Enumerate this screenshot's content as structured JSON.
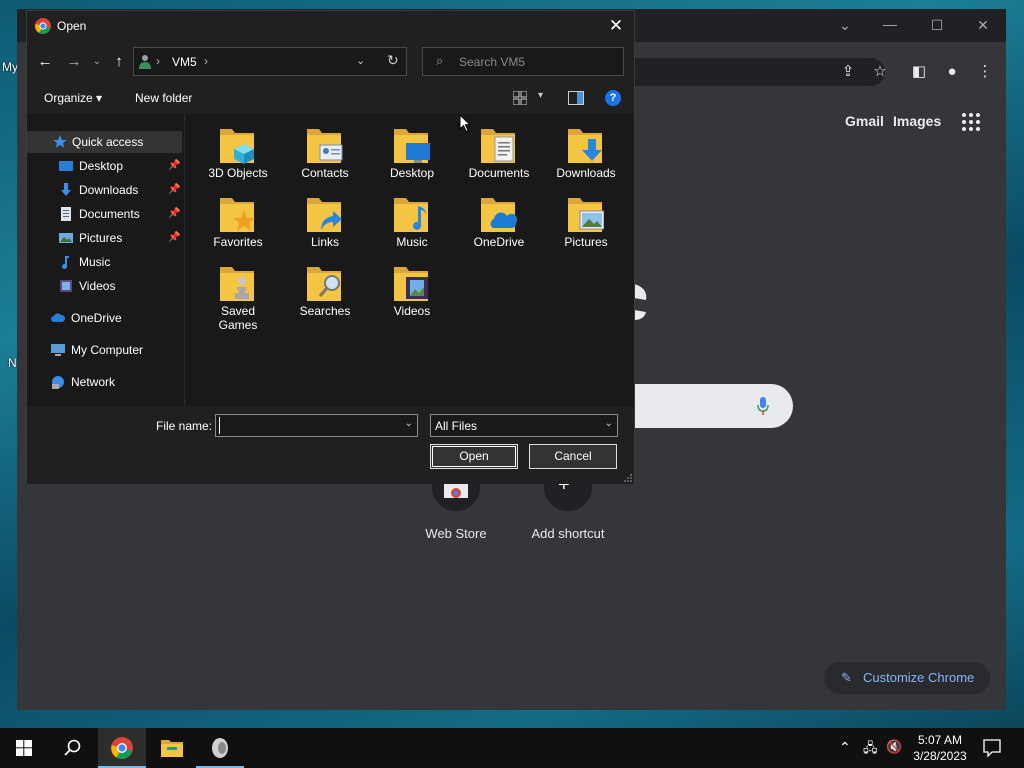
{
  "desktop": {
    "label_my": "My",
    "label_n": "N"
  },
  "chrome_window": {
    "top_links": {
      "gmail": "Gmail",
      "images": "Images"
    },
    "shortcuts": [
      {
        "label": "Web Store"
      },
      {
        "label": "Add shortcut"
      }
    ],
    "customize_label": "Customize Chrome",
    "add_symbol": "+"
  },
  "dialog": {
    "title": "Open",
    "close_glyph": "✕",
    "address": {
      "crumb": "VM5"
    },
    "search_placeholder": "Search VM5",
    "commands": {
      "organize": "Organize ▾",
      "new_folder": "New folder"
    },
    "nav_items": [
      {
        "label": "Quick access",
        "icon": "star-icon"
      },
      {
        "label": "Desktop",
        "icon": "desktop-icon",
        "pinned": true
      },
      {
        "label": "Downloads",
        "icon": "downloads-icon",
        "pinned": true
      },
      {
        "label": "Documents",
        "icon": "documents-icon",
        "pinned": true
      },
      {
        "label": "Pictures",
        "icon": "pictures-icon",
        "pinned": true
      },
      {
        "label": "Music",
        "icon": "music-icon"
      },
      {
        "label": "Videos",
        "icon": "videos-icon"
      },
      {
        "label": "OneDrive",
        "icon": "cloud-icon"
      },
      {
        "label": "My Computer",
        "icon": "computer-icon"
      },
      {
        "label": "Network",
        "icon": "network-icon"
      }
    ],
    "folders": [
      {
        "label": "3D Objects",
        "icon": "3d-objects-folder-icon"
      },
      {
        "label": "Contacts",
        "icon": "contacts-folder-icon"
      },
      {
        "label": "Desktop",
        "icon": "desktop-folder-icon"
      },
      {
        "label": "Documents",
        "icon": "documents-folder-icon"
      },
      {
        "label": "Downloads",
        "icon": "downloads-folder-icon"
      },
      {
        "label": "Favorites",
        "icon": "favorites-folder-icon"
      },
      {
        "label": "Links",
        "icon": "links-folder-icon"
      },
      {
        "label": "Music",
        "icon": "music-folder-icon"
      },
      {
        "label": "OneDrive",
        "icon": "onedrive-folder-icon"
      },
      {
        "label": "Pictures",
        "icon": "pictures-folder-icon"
      },
      {
        "label": "Saved\nGames",
        "icon": "saved-games-folder-icon"
      },
      {
        "label": "Searches",
        "icon": "searches-folder-icon"
      },
      {
        "label": "Videos",
        "icon": "videos-folder-icon"
      }
    ],
    "file_name_label": "File name:",
    "file_name_value": "",
    "file_type": "All Files",
    "open_label": "Open",
    "cancel_label": "Cancel"
  },
  "taskbar": {
    "time": "5:07 AM",
    "date": "3/28/2023"
  },
  "colors": {
    "accent_blue": "#1a73e8",
    "folder_yellow": "#f4c542",
    "chrome_link": "#8ab4f8"
  }
}
